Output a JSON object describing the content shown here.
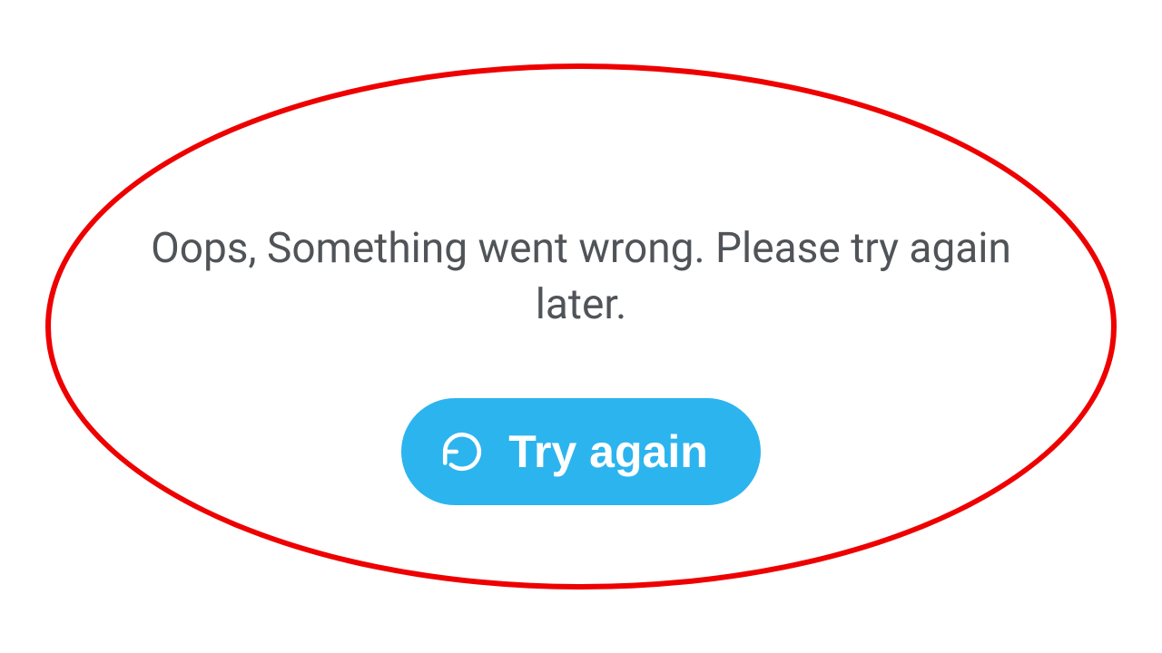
{
  "error": {
    "message": "Oops, Something went wrong. Please try again later."
  },
  "retry": {
    "label": "Try again",
    "icon": "refresh-icon"
  },
  "colors": {
    "button_bg": "#2cb4ef",
    "text": "#505458",
    "annotation": "#ee0000"
  }
}
